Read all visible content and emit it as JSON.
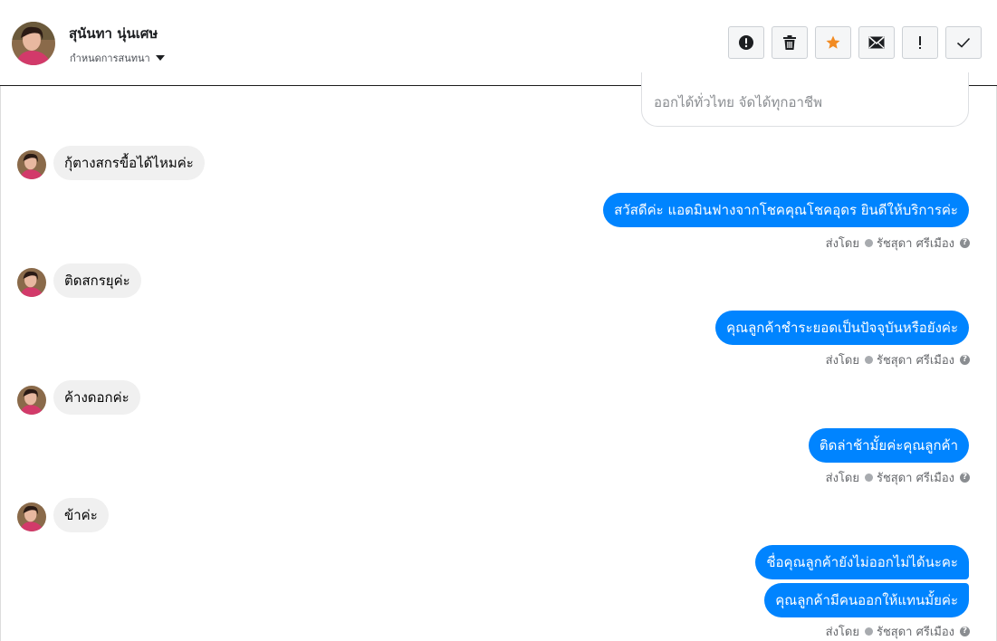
{
  "header": {
    "contact_name": "สุนันทา นุ่นเศษ",
    "assign_label": "กำหนดการสนทนา",
    "tools": [
      {
        "name": "report-spam",
        "icon": "alert-circle-icon"
      },
      {
        "name": "delete",
        "icon": "trash-icon"
      },
      {
        "name": "star",
        "icon": "star-icon",
        "color": "#f28b22"
      },
      {
        "name": "mark-unread",
        "icon": "envelope-icon"
      },
      {
        "name": "follow-up",
        "icon": "exclamation-icon"
      },
      {
        "name": "mark-done",
        "icon": "check-icon"
      }
    ]
  },
  "top_card": {
    "text": "ออกได้ทั่วไทย จัดได้ทุกอาชีพ"
  },
  "messages": {
    "in_1": "กุ้ตางสกรขื้อได้ไหมค่ะ",
    "out_1": "สวัสดีค่ะ แอดมินฟางจากโชคคุณโชคอุดร ยินดีให้บริการค่ะ",
    "in_2": "ติดสกรยุค่ะ",
    "out_2": "คุณลูกค้าชำระยอดเป็นปัจจุบันหรือยังค่ะ",
    "in_3": "ค้างดอกค่ะ",
    "out_3": "ติดล่าช้ามั้ยค่ะคุณลูกค้า",
    "in_4": "ข้าค่ะ",
    "out_4a": "ชื่อคุณลูกค้ายังไม่ออกไม่ได้นะคะ",
    "out_4b": "คุณลูกค้ามีคนออกให้แทนมั้ยค่ะ"
  },
  "sent_by": {
    "prefix": "ส่งโดย",
    "agent": "รัชสุดา ศรีเมือง"
  },
  "colors": {
    "outgoing_bubble": "#0084ff",
    "incoming_bubble": "#f0f0f0",
    "star": "#f28b22"
  }
}
